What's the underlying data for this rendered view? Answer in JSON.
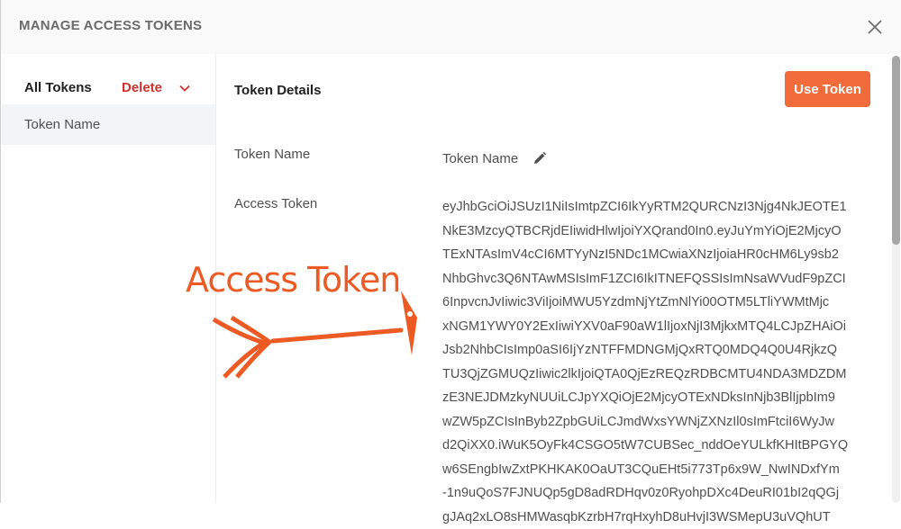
{
  "modal": {
    "title": "MANAGE ACCESS TOKENS",
    "close_icon": "close-icon"
  },
  "sidebar": {
    "header_label": "All Tokens",
    "delete_label": "Delete",
    "dropdown_icon": "chevron-down-icon",
    "items": [
      {
        "label": "Token Name",
        "selected": true
      }
    ]
  },
  "details": {
    "title": "Token Details",
    "use_token_label": "Use Token",
    "token_name_label": "Token Name",
    "token_name_value": "Token Name",
    "edit_icon": "pencil-icon",
    "access_token_label": "Access Token",
    "access_token_lines": [
      "eyJhbGciOiJSUzI1NiIsImtpZCI6IkYyRTM2QURCNzI3Njg4NkJEOTE1",
      "NkE3MzcyQTBCRjdEIiwidHlwIjoiYXQrand0In0.eyJuYmYiOjE2MjcyO",
      "TExNTAsImV4cCI6MTYyNzI5NDc1MCwiaXNzIjoiaHR0cHM6Ly9sb2",
      "NhbGhvc3Q6NTAwMSIsImF1ZCI6IkITNEFQSSIsImNsaWVudF9pZCI",
      "6InpvcnJvIiwic3ViIjoiMWU5YzdmNjYtZmNlYi00OTM5LTliYWMtMjc",
      "xNGM1YWY0Y2ExIiwiYXV0aF90aW1lIjoxNjI3MjkxMTQ4LCJpZHAiOi",
      "Jsb2NhbCIsImp0aSI6IjYzNTFFMDNGMjQxRTQ0MDQ4Q0U4RjkzQ",
      "TU3QjZGMUQzIiwic2lkIjoiQTA0QjEzREQzRDBCMTU4NDA3MDZDM",
      "zE3NEJDMzkyNUUiLCJpYXQiOjE2MjcyOTExNDksInNjb3BlIjpbIm9",
      "wZW5pZCIsInByb2ZpbGUiLCJmdWxsYWNjZXNzIl0sImFtciI6WyJw",
      "d2QiXX0.iWuK5OyFk4CSGO5tW7CUBSec_nddOeYULkfKHItBPGYQ",
      "w6SEngbIwZxtPKHKAK0OaUT3CQuEHt5i773Tp6x9W_NwINDxfYm",
      "-1n9uQoS7FJNUQp5gD8adRDHqv0z0RyohpDXc4DeuRI01bI2qQGj",
      "gJAq2xLO8sHMWasqbKzrbH7rqHxyhD8uHvjI3WSMepU3uVQhUT"
    ]
  },
  "annotation": {
    "text": "Access Token",
    "color": "#ee5a24"
  },
  "colors": {
    "accent": "#f26b3a",
    "danger": "#d0312d"
  }
}
